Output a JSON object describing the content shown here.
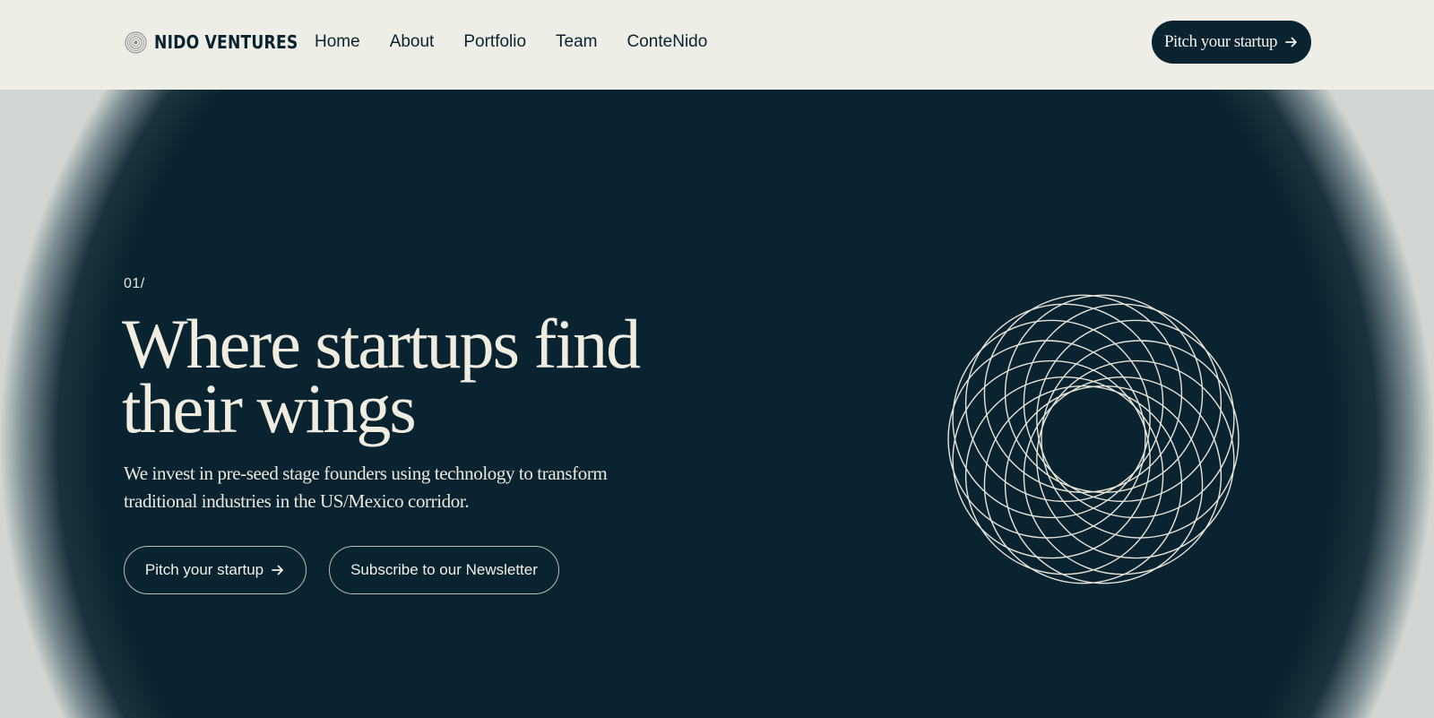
{
  "header": {
    "brand": "NIDO VENTURES",
    "brand_icon": "nest-logo-icon",
    "nav": [
      {
        "label": "Home"
      },
      {
        "label": "About"
      },
      {
        "label": "Portfolio"
      },
      {
        "label": "Team"
      },
      {
        "label": "ConteNido"
      }
    ],
    "cta_label": "Pitch your startup",
    "cta_icon": "arrow-right-icon"
  },
  "hero": {
    "eyebrow": "01/",
    "title": "Where startups find their wings",
    "subtitle": "We invest in pre-seed stage founders using technology to transform traditional industries in the US/Mexico corridor.",
    "primary_button": "Pitch your startup",
    "secondary_button": "Subscribe to our Newsletter",
    "graphic": "rings-spirograph-icon"
  },
  "colors": {
    "navy": "#0a2330",
    "cream": "#eeede6",
    "text_light": "#f0ece0"
  }
}
